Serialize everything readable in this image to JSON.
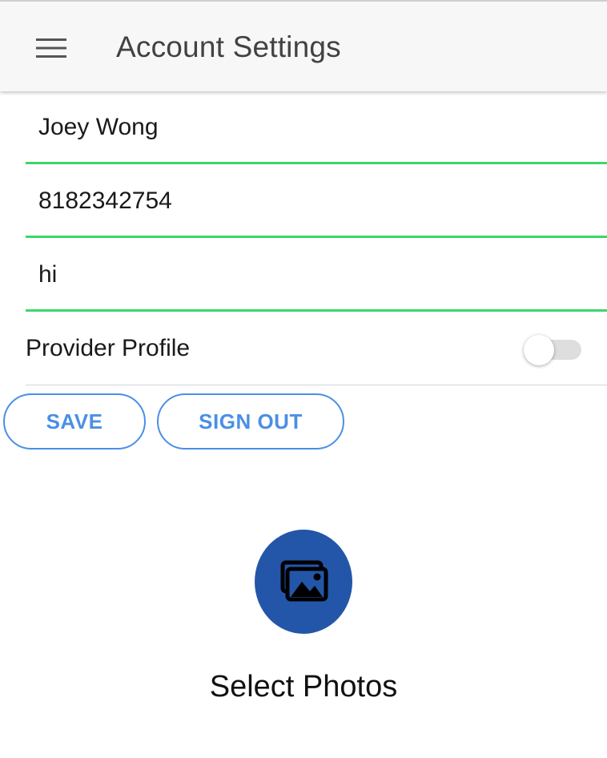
{
  "header": {
    "title": "Account Settings",
    "menu_icon": "hamburger-menu-icon"
  },
  "form": {
    "name_value": "Joey Wong",
    "phone_value": "8182342754",
    "bio_value": "hi",
    "underline_color": "#3dd66a"
  },
  "provider_toggle": {
    "label": "Provider Profile",
    "checked": false
  },
  "buttons": {
    "save_label": "SAVE",
    "sign_out_label": "SIGN OUT",
    "accent_color": "#4a8fe6"
  },
  "photos": {
    "icon": "photo-library-icon",
    "label": "Select Photos",
    "button_color": "#2356a8"
  }
}
